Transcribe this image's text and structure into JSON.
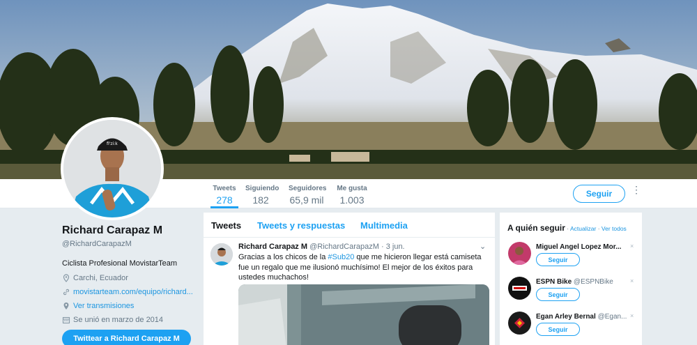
{
  "profile": {
    "name": "Richard Carapaz M",
    "handle": "@RichardCarapazM",
    "bio": "Ciclista Profesional MovistarTeam",
    "location": "Carchi, Ecuador",
    "website": "movistarteam.com/equipo/richard...",
    "broadcasts": "Ver transmisiones",
    "joined": "Se unió en marzo de 2014",
    "tweet_to_label": "Twittear a Richard Carapaz M",
    "cap_text": "fi'zi:k"
  },
  "nav": {
    "stats": [
      {
        "label": "Tweets",
        "value": "278"
      },
      {
        "label": "Siguiendo",
        "value": "182"
      },
      {
        "label": "Seguidores",
        "value": "65,9 mil"
      },
      {
        "label": "Me gusta",
        "value": "1.003"
      }
    ],
    "follow_label": "Seguir",
    "more_glyph": "⋮"
  },
  "timeline": {
    "tabs": [
      "Tweets",
      "Tweets y respuestas",
      "Multimedia"
    ],
    "tweet": {
      "name": "Richard Carapaz M",
      "handle": "@RichardCarapazM",
      "sep": "·",
      "date": "3 jun.",
      "text_before": "Gracias a los chicos de la ",
      "hashtag": "#Sub20",
      "text_after": " que me hicieron llegar está camiseta fue un regalo que me ilusionó muchísimo! El mejor de los éxitos para ustedes muchachos!",
      "chevron": "⌄"
    }
  },
  "who_to_follow": {
    "title": "A quién seguir",
    "sep1": " · ",
    "refresh": "Actualizar",
    "sep2": " · ",
    "view_all": "Ver todos",
    "close_glyph": "×",
    "follow_label": "Seguir",
    "suggestions": [
      {
        "name": "Miguel Angel Lopez Mor...",
        "handle": ""
      },
      {
        "name": "ESPN Bike",
        "handle": "@ESPNBike"
      },
      {
        "name": "Egan Arley Bernal",
        "handle": "@Egan..."
      }
    ]
  },
  "colors": {
    "accent": "#1da1f2",
    "link": "#1b95e0",
    "background": "#e6ecf0"
  }
}
